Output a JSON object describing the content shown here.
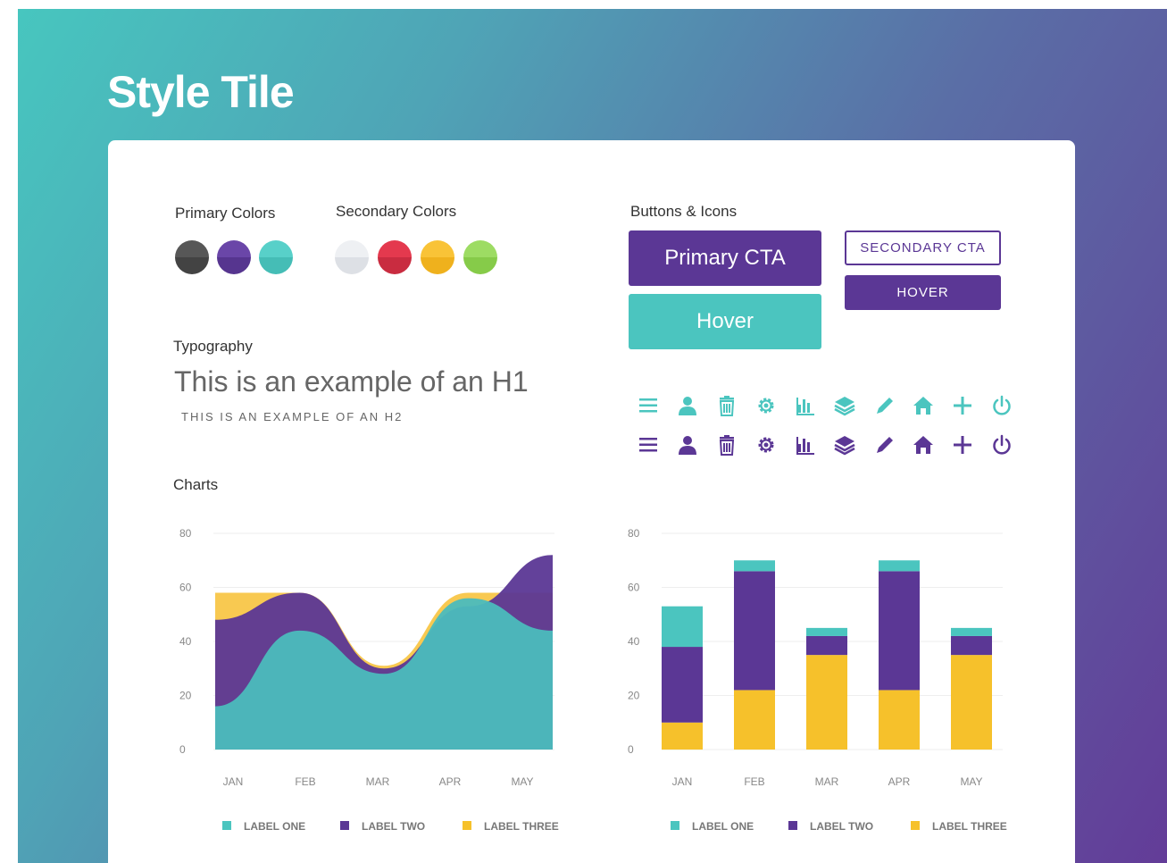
{
  "page": {
    "title": "Style Tile"
  },
  "sections": {
    "primary_colors": "Primary Colors",
    "secondary_colors": "Secondary Colors",
    "typography": "Typography",
    "charts": "Charts",
    "buttons_icons": "Buttons & Icons"
  },
  "colors": {
    "primary": [
      {
        "name": "dark-gray",
        "top": "#575757",
        "bottom": "#434343"
      },
      {
        "name": "purple",
        "top": "#6a46a8",
        "bottom": "#56358f"
      },
      {
        "name": "teal",
        "top": "#58d0c9",
        "bottom": "#45bdb6"
      }
    ],
    "secondary": [
      {
        "name": "light-gray",
        "top": "#eef0f3",
        "bottom": "#dde0e5"
      },
      {
        "name": "red",
        "top": "#e4394e",
        "bottom": "#c92c40"
      },
      {
        "name": "yellow",
        "top": "#f9c337",
        "bottom": "#efb11d"
      },
      {
        "name": "green",
        "top": "#9ddc63",
        "bottom": "#86cb49"
      }
    ]
  },
  "typography": {
    "h1": "This is an example of an H1",
    "h2": "THIS IS AN EXAMPLE OF AN H2"
  },
  "buttons": {
    "primary_cta": "Primary CTA",
    "primary_hover": "Hover",
    "secondary_cta": "SECONDARY CTA",
    "secondary_hover": "HOVER"
  },
  "icons": {
    "names": [
      "menu-icon",
      "user-icon",
      "trash-icon",
      "gear-icon",
      "bar-chart-icon",
      "layers-icon",
      "pencil-icon",
      "home-icon",
      "plus-icon",
      "power-icon"
    ],
    "row_colors": [
      "#4bc5bf",
      "#5b3795"
    ]
  },
  "chart_data": [
    {
      "type": "area",
      "categories": [
        "JAN",
        "FEB",
        "MAR",
        "APR",
        "MAY"
      ],
      "y_ticks": [
        "0",
        "20",
        "40",
        "60",
        "80"
      ],
      "ylim": [
        0,
        80
      ],
      "series": [
        {
          "name": "LABEL THREE",
          "color": "#f8c648",
          "values": [
            58,
            58,
            31,
            58,
            58
          ]
        },
        {
          "name": "LABEL TWO",
          "color": "#5b3795",
          "values": [
            48,
            58,
            30,
            53,
            72
          ]
        },
        {
          "name": "LABEL ONE",
          "color": "#4bbcbd",
          "values": [
            16,
            44,
            28,
            56,
            44
          ]
        }
      ],
      "legend": [
        "LABEL ONE",
        "LABEL TWO",
        "LABEL THREE"
      ]
    },
    {
      "type": "bar",
      "stacked": true,
      "categories": [
        "JAN",
        "FEB",
        "MAR",
        "APR",
        "MAY"
      ],
      "y_ticks": [
        "0",
        "20",
        "40",
        "60",
        "80"
      ],
      "ylim": [
        0,
        80
      ],
      "series": [
        {
          "name": "LABEL THREE",
          "color": "#f6c12b",
          "values": [
            10,
            22,
            35,
            22,
            35
          ]
        },
        {
          "name": "LABEL TWO",
          "color": "#5b3795",
          "values": [
            28,
            44,
            7,
            44,
            7
          ]
        },
        {
          "name": "LABEL ONE",
          "color": "#4bc5bf",
          "values": [
            15,
            4,
            3,
            4,
            3
          ]
        }
      ],
      "legend": [
        "LABEL ONE",
        "LABEL TWO",
        "LABEL THREE"
      ]
    }
  ],
  "legend_colors": {
    "LABEL ONE": "#4bc5bf",
    "LABEL TWO": "#5b3795",
    "LABEL THREE": "#f6c12b"
  }
}
